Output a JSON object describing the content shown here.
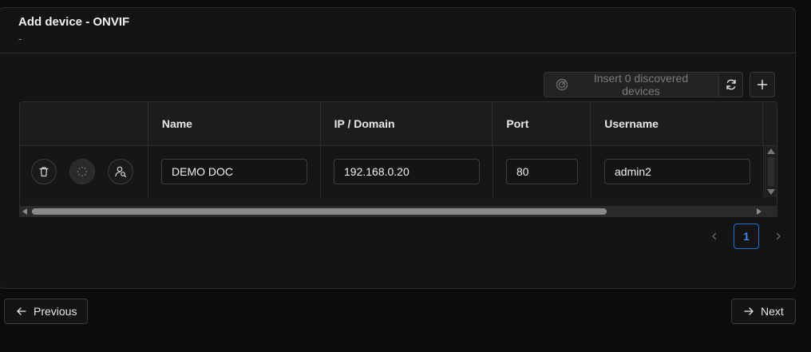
{
  "dialog": {
    "title": "Add device - ONVIF",
    "subtitle": "-"
  },
  "toolbar": {
    "insert_label": "Insert 0 discovered devices",
    "insert_icon": "radar-icon",
    "refresh_icon": "refresh-icon",
    "add_icon": "plus-icon"
  },
  "table": {
    "columns": [
      "",
      "Name",
      "IP / Domain",
      "Port",
      "Username",
      ""
    ],
    "rows": [
      {
        "actions": [
          "trash-icon",
          "spinner-icon",
          "user-search-icon"
        ],
        "name": "DEMO DOC",
        "ip": "192.168.0.20",
        "port": "80",
        "username": "admin2"
      }
    ]
  },
  "pagination": {
    "current_page": "1"
  },
  "footer": {
    "previous_label": "Previous",
    "next_label": "Next"
  },
  "colors": {
    "background": "#0c0c0c",
    "card": "#141414",
    "accent": "#1f6fd6"
  }
}
